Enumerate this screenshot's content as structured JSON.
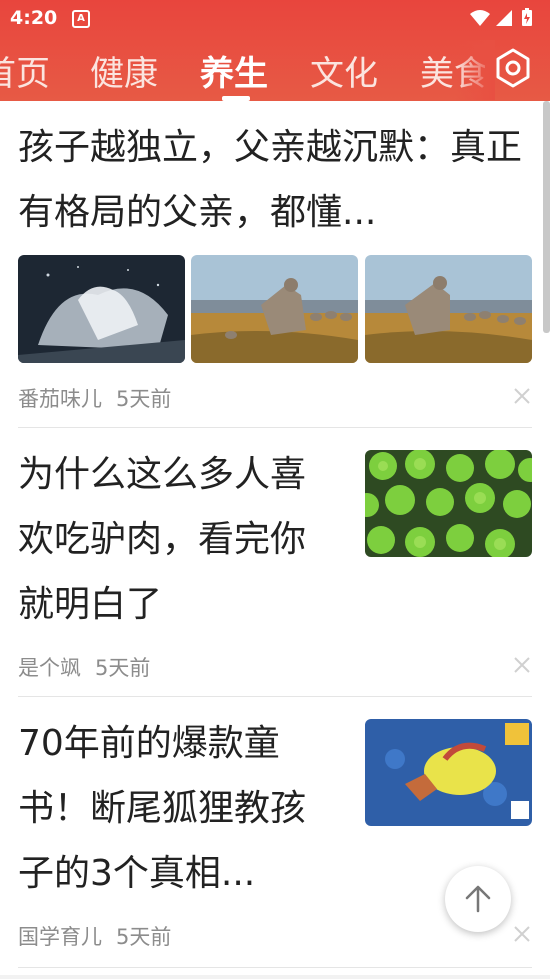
{
  "status": {
    "time": "4:20",
    "notification_badge": "A"
  },
  "tabs": {
    "items": [
      "首页",
      "健康",
      "养生",
      "文化",
      "美食"
    ],
    "active": "养生"
  },
  "articles": [
    {
      "title": "孩子越独立，父亲越沉默：真正有格局的父亲，都懂...",
      "author": "番茄味儿",
      "time": "5天前"
    },
    {
      "title": "为什么这么多人喜欢吃驴肉，看完你就明白了",
      "author": "是个飒",
      "time": "5天前"
    },
    {
      "title": "70年前的爆款童书！断尾狐狸教孩子的3个真相...",
      "author": "国学育儿",
      "time": "5天前"
    }
  ],
  "icons": {
    "settings": "settings-hex-icon",
    "close": "close-icon",
    "back_to_top": "arrow-up-icon"
  },
  "colors": {
    "header": "#e8453d",
    "text": "#222222",
    "meta": "#8c8c8c"
  }
}
